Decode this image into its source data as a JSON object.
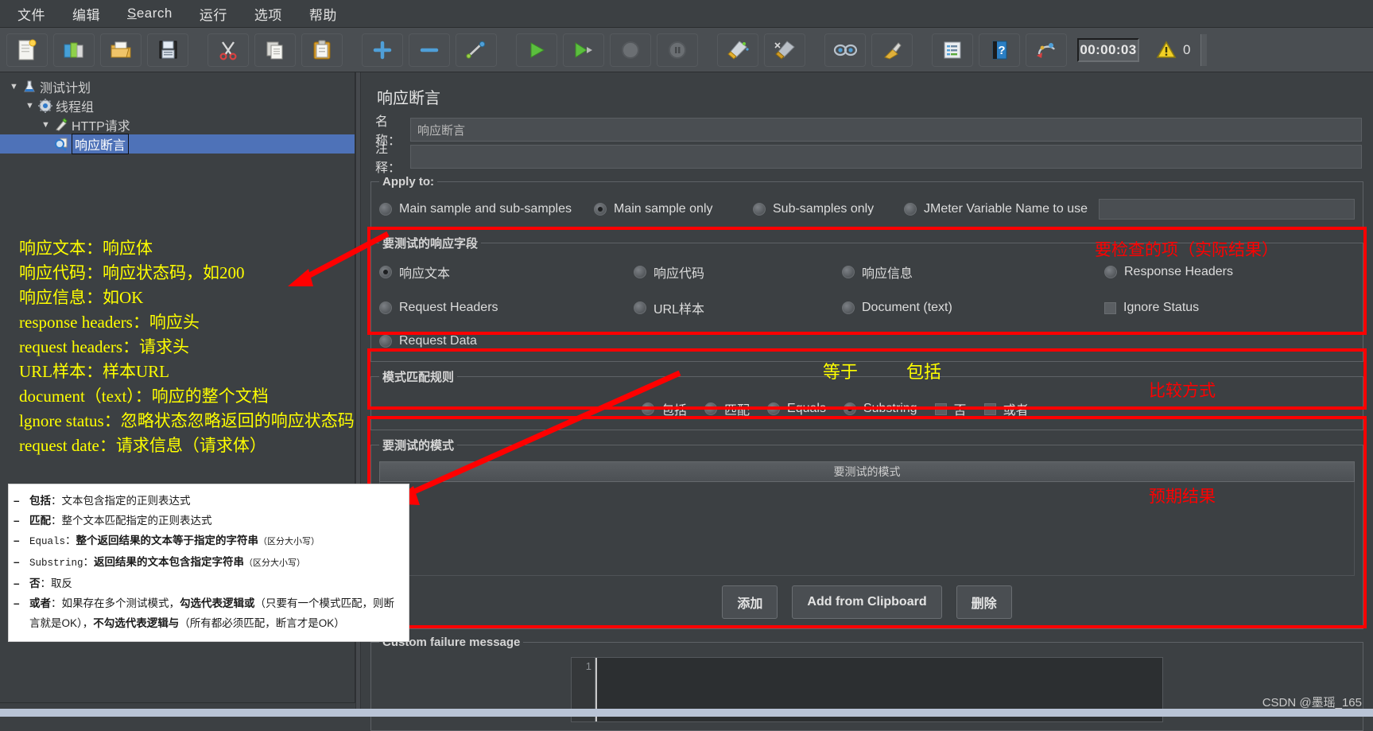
{
  "window": {
    "menu": [
      {
        "label": "文件"
      },
      {
        "label": "编辑"
      },
      {
        "label": "Search",
        "accel": "S"
      },
      {
        "label": "运行"
      },
      {
        "label": "选项"
      },
      {
        "label": "帮助"
      }
    ],
    "toolbar": {
      "buttons": [
        {
          "name": "new-icon"
        },
        {
          "name": "templates-icon"
        },
        {
          "name": "open-icon"
        },
        {
          "name": "save-icon"
        },
        {
          "name": "cut-icon"
        },
        {
          "name": "copy-icon"
        },
        {
          "name": "paste-icon"
        },
        {
          "name": "expand-icon"
        },
        {
          "name": "collapse-icon"
        },
        {
          "name": "toggle-icon"
        },
        {
          "name": "start-icon"
        },
        {
          "name": "start-no-pause-icon"
        },
        {
          "name": "stop-icon"
        },
        {
          "name": "shutdown-icon"
        },
        {
          "name": "clear-icon"
        },
        {
          "name": "clear-all-icon"
        },
        {
          "name": "search-icon"
        },
        {
          "name": "search-reset-icon"
        },
        {
          "name": "function-helper-icon"
        },
        {
          "name": "help-icon"
        },
        {
          "name": "undo-redo-icon"
        }
      ],
      "timer": "00:00:03",
      "warning_count": "0"
    }
  },
  "tree": {
    "nodes": [
      {
        "label": "测试计划",
        "icon": "test-plan-icon",
        "level": 1,
        "expanded": true,
        "selected": false
      },
      {
        "label": "线程组",
        "icon": "thread-group-icon",
        "level": 2,
        "expanded": true,
        "selected": false
      },
      {
        "label": "HTTP请求",
        "icon": "http-request-icon",
        "level": 3,
        "expanded": true,
        "selected": false
      },
      {
        "label": "响应断言",
        "icon": "assertion-icon",
        "level": 4,
        "expanded": false,
        "selected": true
      }
    ]
  },
  "panel": {
    "title": "响应断言",
    "name_label": "名称：",
    "name_value": "响应断言",
    "comment_label": "注释：",
    "comment_value": "",
    "apply_to": {
      "legend": "Apply to:",
      "options": [
        {
          "label": "Main sample and sub-samples",
          "selected": false
        },
        {
          "label": "Main sample only",
          "selected": true
        },
        {
          "label": "Sub-samples only",
          "selected": false
        },
        {
          "label": "JMeter Variable Name to use",
          "selected": false
        }
      ],
      "variable_value": ""
    },
    "response_field": {
      "legend": "要测试的响应字段",
      "options": [
        {
          "label": "响应文本",
          "type": "radio",
          "selected": true
        },
        {
          "label": "响应代码",
          "type": "radio",
          "selected": false
        },
        {
          "label": "响应信息",
          "type": "radio",
          "selected": false
        },
        {
          "label": "Response Headers",
          "type": "radio",
          "selected": false
        },
        {
          "label": "Request Headers",
          "type": "radio",
          "selected": false
        },
        {
          "label": "URL样本",
          "type": "radio",
          "selected": false
        },
        {
          "label": "Document (text)",
          "type": "radio",
          "selected": false
        },
        {
          "label": "Ignore Status",
          "type": "checkbox",
          "selected": false
        },
        {
          "label": "Request Data",
          "type": "radio",
          "selected": false
        }
      ]
    },
    "pattern_rules": {
      "legend": "模式匹配规则",
      "options": [
        {
          "label": "包括",
          "type": "radio",
          "selected": false
        },
        {
          "label": "匹配",
          "type": "radio",
          "selected": false
        },
        {
          "label": "Equals",
          "type": "radio",
          "selected": false
        },
        {
          "label": "Substring",
          "type": "radio",
          "selected": true
        },
        {
          "label": "否",
          "type": "checkbox",
          "selected": false
        },
        {
          "label": "或者",
          "type": "checkbox",
          "selected": false
        }
      ]
    },
    "patterns": {
      "legend": "要测试的模式",
      "column_header": "要测试的模式",
      "rows": [],
      "buttons": [
        {
          "label": "添加",
          "name": "add-button"
        },
        {
          "label": "Add from Clipboard",
          "name": "add-from-clipboard-button"
        },
        {
          "label": "删除",
          "name": "delete-button"
        }
      ]
    },
    "failure_message": {
      "legend": "Custom failure message",
      "line_number": "1",
      "value": ""
    }
  },
  "annotations": {
    "yellow_lines": [
      "响应文本：响应体",
      "响应代码：响应状态码，如200",
      "响应信息：如OK",
      "response headers：响应头",
      "request headers：请求头",
      "URL样本：样本URL",
      "document（text）：响应的整个文档",
      "lgnore status：忽略状态忽略返回的响应状态码",
      "request date：请求信息（请求体）"
    ],
    "yellow_equals": "等于",
    "yellow_includes": "包括",
    "red_check_item": "要检查的项（实际结果）",
    "red_compare_mode": "比较方式",
    "red_expected_result": "预期结果"
  },
  "popup": {
    "items": [
      {
        "term": "包括",
        "term_mono": false,
        "desc": "文本包含指定的正则表达式"
      },
      {
        "term": "匹配",
        "term_mono": false,
        "desc": "整个文本匹配指定的正则表达式"
      },
      {
        "term": "Equals",
        "term_mono": true,
        "desc": "整个返回结果的文本等于指定的字符串",
        "note": "（区分大小写）"
      },
      {
        "term": "Substring",
        "term_mono": true,
        "desc": "返回结果的文本包含指定字符串",
        "note": "（区分大小写）"
      },
      {
        "term": "否",
        "term_mono": false,
        "desc": "取反"
      }
    ],
    "last_term": "或者",
    "last_parts": [
      "：如果存在多个测试模式，",
      "勾选代表逻辑或",
      "（只要有一个模式匹配，则断言就是OK），",
      "不勾选代表逻辑与",
      "（所有都必须匹配，断言才是OK）"
    ]
  },
  "watermark": "CSDN @墨瑶_165",
  "colors": {
    "accent_red": "#ff0000",
    "accent_yellow": "#ffff00",
    "selection_blue": "#4e72b8",
    "panel_bg": "#3c4043"
  }
}
